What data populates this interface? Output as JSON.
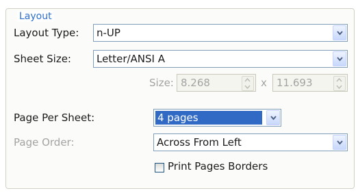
{
  "group": {
    "legend": "Layout"
  },
  "layout_type": {
    "label": "Layout Type:",
    "value": "n-UP",
    "icon": "chevron-down-icon"
  },
  "sheet_size": {
    "label": "Sheet Size:",
    "value": "Letter/ANSI A",
    "icon": "chevron-down-icon"
  },
  "size": {
    "label": "Size:",
    "width": "8.268",
    "separator": "x",
    "height": "11.693"
  },
  "page_per_sheet": {
    "label": "Page Per Sheet:",
    "value": "4 pages",
    "icon": "chevron-down-icon"
  },
  "page_order": {
    "label": "Page Order:",
    "value": "Across From Left",
    "icon": "chevron-down-icon"
  },
  "print_borders": {
    "label": "Print Pages Borders",
    "checked": false
  },
  "colors": {
    "accent": "#2d6fd1",
    "selection": "#316ac5",
    "disabled_text": "#a3a3a3"
  }
}
